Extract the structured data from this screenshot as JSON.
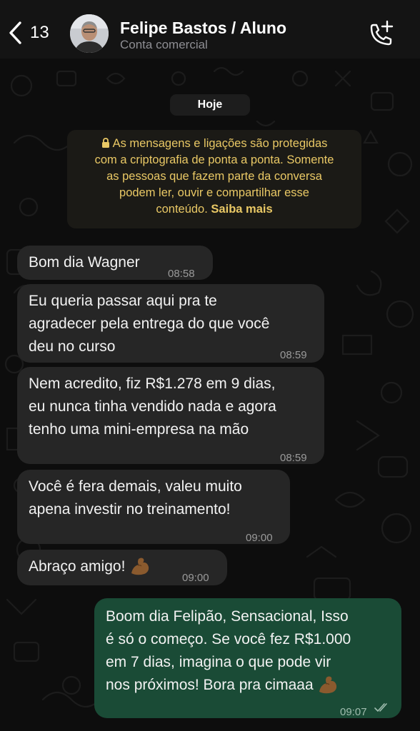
{
  "header": {
    "back_count": "13",
    "contact_name": "Felipe Bastos / Aluno",
    "contact_subtitle": "Conta comercial",
    "icons": [
      "chevron-left-icon",
      "avatar",
      "add-call-icon"
    ]
  },
  "chat": {
    "date_label": "Hoje",
    "encryption_notice": {
      "lines": [
        "As mensagens e ligações são protegidas",
        "com a criptografia de ponta a ponta. Somente",
        "as pessoas que fazem parte da conversa",
        "podem ler, ouvir e compartilhar esse",
        "conteúdo."
      ],
      "link": "Saiba mais"
    },
    "messages": [
      {
        "direction": "incoming",
        "lines": [
          "Bom dia Wagner"
        ],
        "time": "08:58"
      },
      {
        "direction": "incoming",
        "lines": [
          "Eu queria passar aqui pra te",
          "agradecer pela entrega do que você",
          "deu no curso"
        ],
        "time": "08:59"
      },
      {
        "direction": "incoming",
        "lines": [
          "Nem acredito, fiz R$1.278 em 9 dias,",
          "eu nunca tinha vendido nada e agora",
          "tenho uma mini-empresa na mão"
        ],
        "time": "08:59"
      },
      {
        "direction": "incoming",
        "lines": [
          "Você é fera demais, valeu muito",
          "apena investir no treinamento!"
        ],
        "time": "09:00"
      },
      {
        "direction": "incoming",
        "lines": [
          "Abraço amigo!"
        ],
        "time": "09:00",
        "emoji": "flexed-biceps"
      },
      {
        "direction": "outgoing",
        "lines": [
          "Boom dia Felipão, Sensacional, Isso",
          "é só o começo. Se você fez R$1.000",
          "em 7 dias, imagina o que pode vir",
          "nos próximos! Bora pra cimaaa"
        ],
        "time": "09:07",
        "emoji": "flexed-biceps",
        "status": "read"
      }
    ]
  },
  "colors": {
    "background": "#0d0d0d",
    "header": "#141414",
    "incoming_bubble": "#262626",
    "outgoing_bubble": "#1a4b36",
    "notice_text": "#e9c865",
    "read_ticks": "#9fbcae"
  }
}
